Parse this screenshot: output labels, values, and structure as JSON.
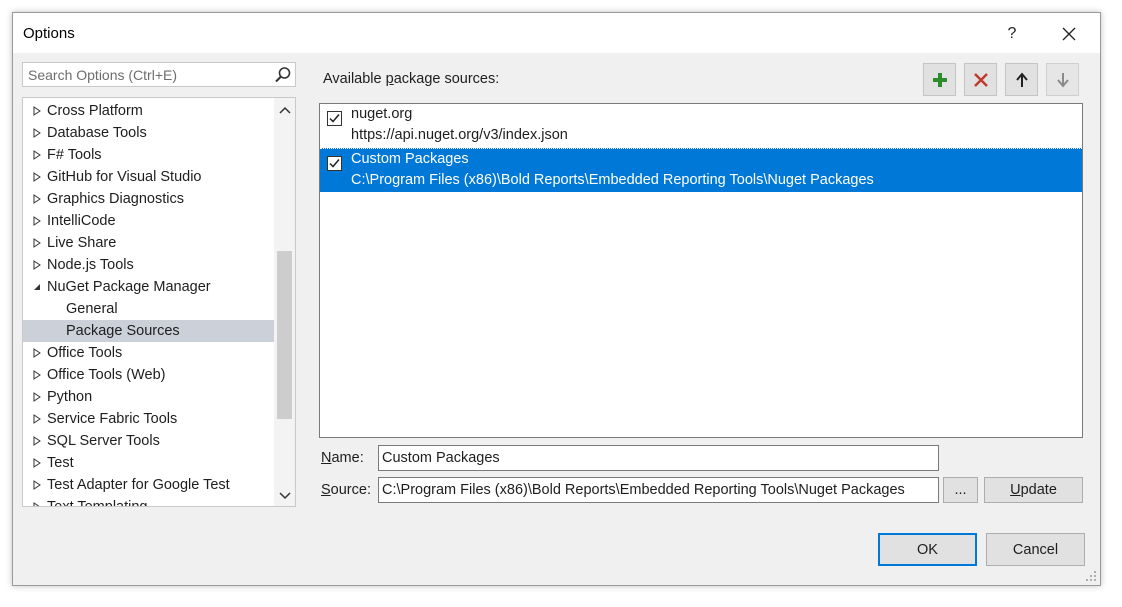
{
  "window": {
    "title": "Options",
    "help_label": "?",
    "close_label": "✕"
  },
  "search": {
    "placeholder": "Search Options (Ctrl+E)",
    "value": ""
  },
  "tree": {
    "items": [
      {
        "label": "Cross Platform",
        "state": "collapsed",
        "level": 0
      },
      {
        "label": "Database Tools",
        "state": "collapsed",
        "level": 0
      },
      {
        "label": "F# Tools",
        "state": "collapsed",
        "level": 0
      },
      {
        "label": "GitHub for Visual Studio",
        "state": "collapsed",
        "level": 0
      },
      {
        "label": "Graphics Diagnostics",
        "state": "collapsed",
        "level": 0
      },
      {
        "label": "IntelliCode",
        "state": "collapsed",
        "level": 0
      },
      {
        "label": "Live Share",
        "state": "collapsed",
        "level": 0
      },
      {
        "label": "Node.js Tools",
        "state": "collapsed",
        "level": 0
      },
      {
        "label": "NuGet Package Manager",
        "state": "expanded",
        "level": 0
      },
      {
        "label": "General",
        "state": "leaf",
        "level": 1
      },
      {
        "label": "Package Sources",
        "state": "leaf",
        "level": 1,
        "selected": true
      },
      {
        "label": "Office Tools",
        "state": "collapsed",
        "level": 0
      },
      {
        "label": "Office Tools (Web)",
        "state": "collapsed",
        "level": 0
      },
      {
        "label": "Python",
        "state": "collapsed",
        "level": 0
      },
      {
        "label": "Service Fabric Tools",
        "state": "collapsed",
        "level": 0
      },
      {
        "label": "SQL Server Tools",
        "state": "collapsed",
        "level": 0
      },
      {
        "label": "Test",
        "state": "collapsed",
        "level": 0
      },
      {
        "label": "Test Adapter for Google Test",
        "state": "collapsed",
        "level": 0
      },
      {
        "label": "Text Templating",
        "state": "collapsed",
        "level": 0
      }
    ]
  },
  "sources_panel": {
    "label_prefix": "Available ",
    "label_accel": "p",
    "label_suffix": "ackage sources:",
    "toolbar": {
      "add_icon": "plus-icon",
      "remove_icon": "x-icon",
      "up_icon": "arrow-up-icon",
      "down_icon": "arrow-down-icon"
    },
    "sources": [
      {
        "name": "nuget.org",
        "url": "https://api.nuget.org/v3/index.json",
        "checked": true,
        "selected": false
      },
      {
        "name": "Custom Packages",
        "url": "C:\\Program Files (x86)\\Bold Reports\\Embedded Reporting Tools\\Nuget Packages",
        "checked": true,
        "selected": true
      }
    ]
  },
  "form": {
    "name_label_accel": "N",
    "name_label_rest": "ame:",
    "name_value": "Custom Packages",
    "source_label_accel": "S",
    "source_label_rest": "ource:",
    "source_value": "C:\\Program Files (x86)\\Bold Reports\\Embedded Reporting Tools\\Nuget Packages",
    "browse_label": "...",
    "update_label_accel": "U",
    "update_label_rest": "pdate"
  },
  "footer": {
    "ok_label": "OK",
    "cancel_label": "Cancel"
  },
  "colors": {
    "selection": "#0078d7",
    "tree_selection": "#ccd0d9",
    "add_green": "#2e8b2e",
    "remove_red": "#c0392b"
  }
}
